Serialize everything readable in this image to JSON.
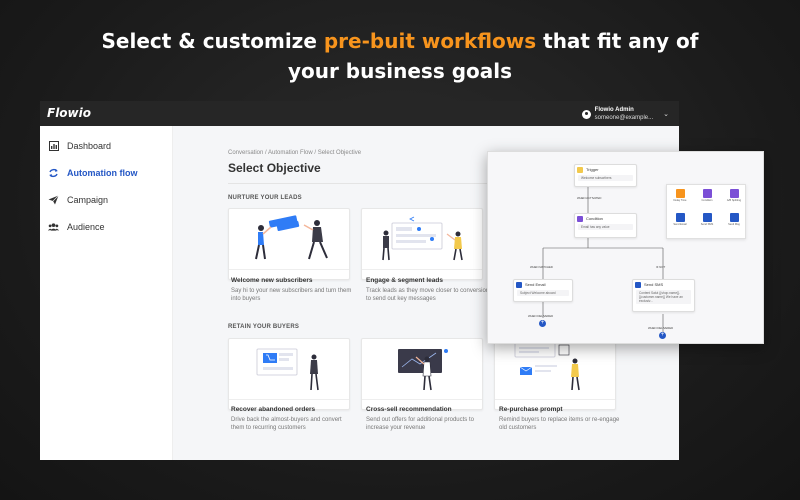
{
  "headline": {
    "part1": "Select & customize ",
    "accent": "pre-buit workflows",
    "part2": " that fit any of",
    "line2": "your business goals"
  },
  "app": {
    "logo": "Flowio",
    "user_name": "Flowio Admin",
    "user_email": "someone@example..."
  },
  "sidebar": {
    "items": [
      {
        "label": "Dashboard",
        "icon": "chart-bar-icon",
        "active": false
      },
      {
        "label": "Automation flow",
        "icon": "sync-arrows-icon",
        "active": true
      },
      {
        "label": "Campaign",
        "icon": "paper-plane-icon",
        "active": false
      },
      {
        "label": "Audience",
        "icon": "users-icon",
        "active": false
      }
    ]
  },
  "main": {
    "breadcrumb": "Conversation  /  Automation Flow  /  Select Objective",
    "title": "Select Objective",
    "sections": [
      {
        "label": "NURTURE YOUR LEADS"
      },
      {
        "label": "RETAIN YOUR BUYERS"
      }
    ],
    "cards": [
      {
        "title": "Welcome new subscribers",
        "desc": "Say hi to your new subscribers and turn them into buyers"
      },
      {
        "title": "Engage & segment leads",
        "desc": "Track leads as they move closer to conversion to send out key messages"
      },
      {
        "title": "Recover abandoned orders",
        "desc": "Drive back the almost-buyers and convert them to recurring customers"
      },
      {
        "title": "Cross-sell recommendation",
        "desc": "Send out offers for additional products to increase your revenue"
      },
      {
        "title": "Re-purchase prompt",
        "desc": "Remind buyers to replace items or re-engage old customers"
      }
    ]
  },
  "flow": {
    "trigger": {
      "title": "Trigger",
      "body": "Welcome subscribers"
    },
    "when_activated": "WHEN ACTIVATED",
    "condition": {
      "title": "Condition",
      "body": "Email has any value"
    },
    "when_matched": "WHEN MATCHED",
    "if_not": "IF NOT",
    "send_email": {
      "title": "Send Email",
      "body": "Subject  Welcome aboard"
    },
    "send_sms": {
      "title": "Send SMS",
      "body": "Content  Salut {{shop.name}}. {{customer.name}} We have an exclusiv..."
    },
    "when_delivered": "WHEN DELIVERED",
    "palette": [
      {
        "label": "Delay Time",
        "color": "#f7941d"
      },
      {
        "label": "Condition",
        "color": "#7b4fd6"
      },
      {
        "label": "A/B Splitting",
        "color": "#7b4fd6"
      },
      {
        "label": "Send Email",
        "color": "#2457c5"
      },
      {
        "label": "Send SMS",
        "color": "#2457c5"
      },
      {
        "label": "Send Msg",
        "color": "#2457c5"
      }
    ]
  },
  "colors": {
    "accent": "#f7941d",
    "primary": "#2457c5",
    "purple": "#7b4fd6",
    "topbar": "#262626"
  }
}
